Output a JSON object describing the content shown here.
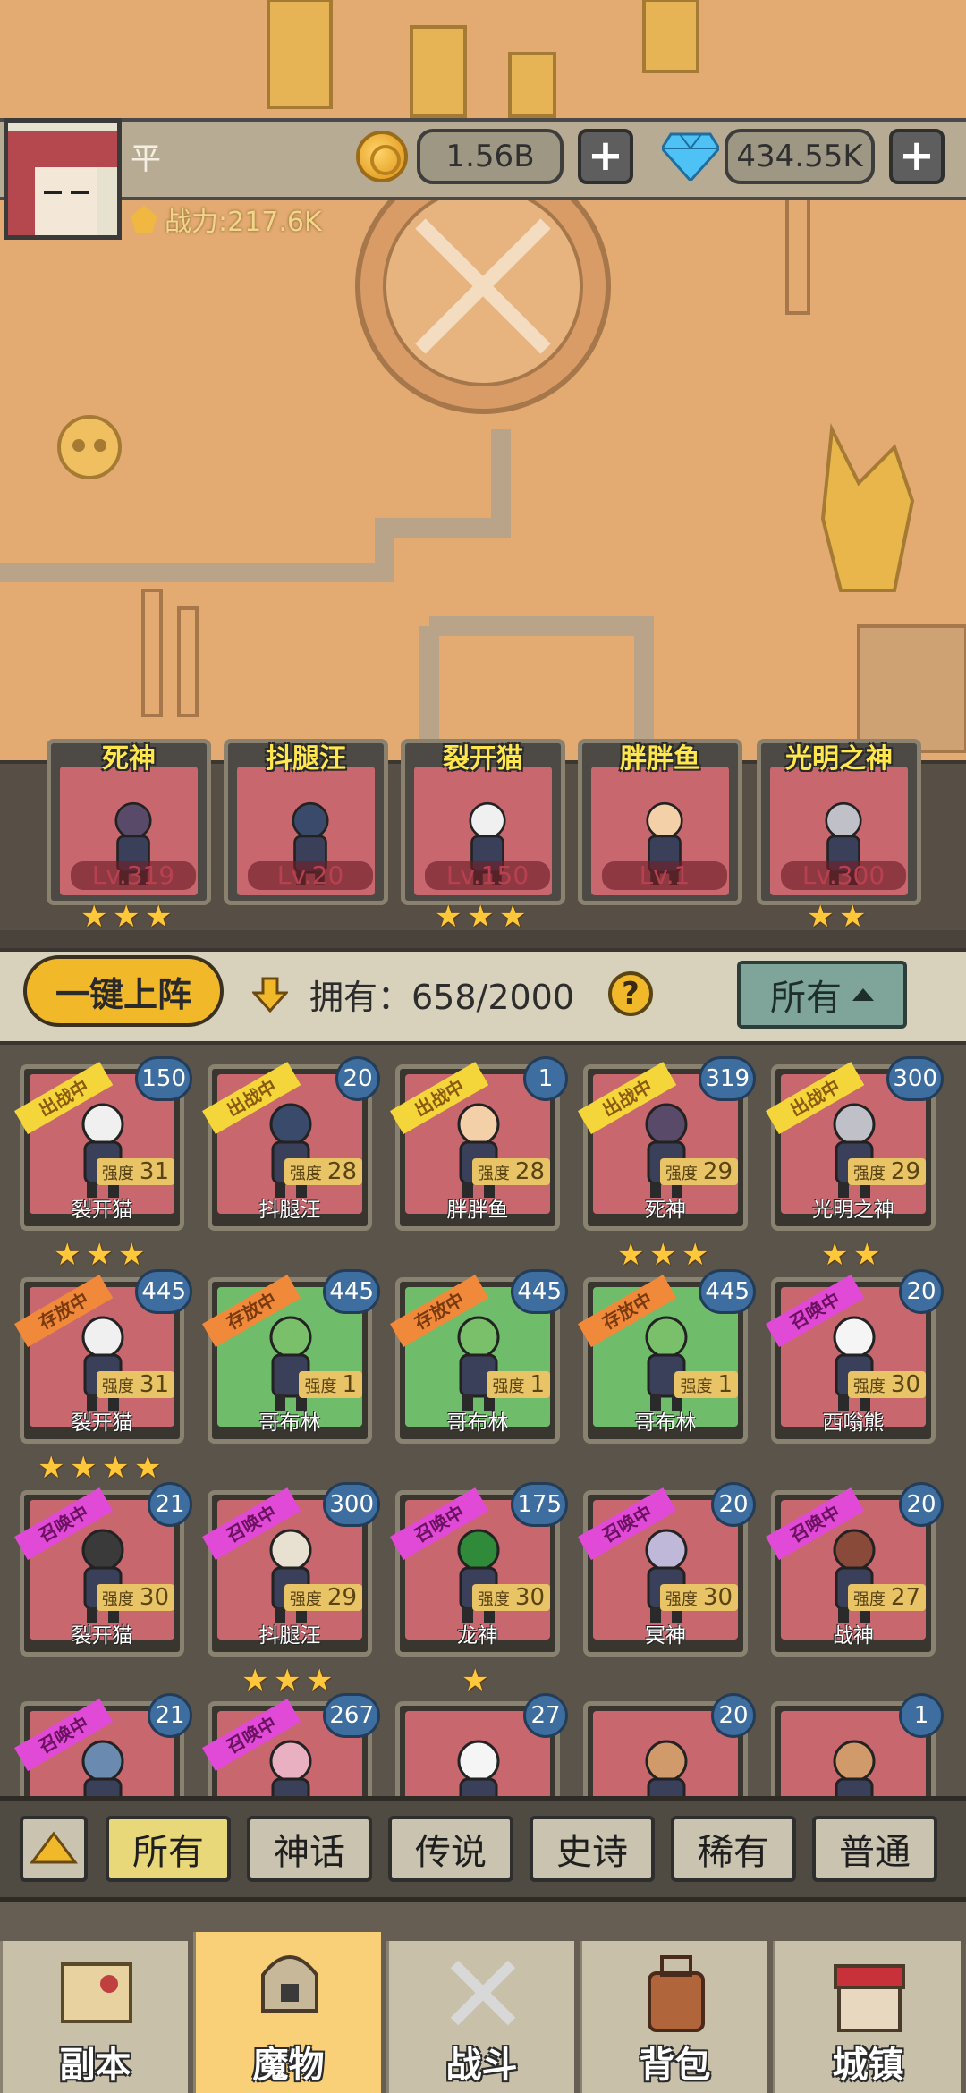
{
  "header": {
    "player_name": "平",
    "gold": "1.56B",
    "gems": "434.55K",
    "power": "战力:217.6K"
  },
  "lineup": [
    {
      "name": "死神",
      "level": "Lv.319",
      "stars": 3
    },
    {
      "name": "抖腿汪",
      "level": "Lv.20",
      "stars": 0
    },
    {
      "name": "裂开猫",
      "level": "Lv.150",
      "stars": 3
    },
    {
      "name": "胖胖鱼",
      "level": "Lv.1",
      "stars": 0
    },
    {
      "name": "光明之神",
      "level": "Lv.300",
      "stars": 2
    }
  ],
  "controls": {
    "auto_deploy": "一键上阵",
    "owned": "拥有：658/2000",
    "help": "?",
    "filter": "所有"
  },
  "grid": {
    "strength_label": "强度",
    "cards": [
      {
        "name": "裂开猫",
        "level": "150",
        "strength": "31",
        "status": "出战中",
        "type": "deployed",
        "bg": "red",
        "stars": 3
      },
      {
        "name": "抖腿汪",
        "level": "20",
        "strength": "28",
        "status": "出战中",
        "type": "deployed",
        "bg": "red",
        "stars": 0
      },
      {
        "name": "胖胖鱼",
        "level": "1",
        "strength": "28",
        "status": "出战中",
        "type": "deployed",
        "bg": "red",
        "stars": 0
      },
      {
        "name": "死神",
        "level": "319",
        "strength": "29",
        "status": "出战中",
        "type": "deployed",
        "bg": "red",
        "stars": 3
      },
      {
        "name": "光明之神",
        "level": "300",
        "strength": "29",
        "status": "出战中",
        "type": "deployed",
        "bg": "red",
        "stars": 2
      },
      {
        "name": "裂开猫",
        "level": "445",
        "strength": "31",
        "status": "存放中",
        "type": "stored",
        "bg": "red",
        "stars": 4
      },
      {
        "name": "哥布林",
        "level": "445",
        "strength": "1",
        "status": "存放中",
        "type": "stored",
        "bg": "green",
        "stars": 0
      },
      {
        "name": "哥布林",
        "level": "445",
        "strength": "1",
        "status": "存放中",
        "type": "stored",
        "bg": "green",
        "stars": 0
      },
      {
        "name": "哥布林",
        "level": "445",
        "strength": "1",
        "status": "存放中",
        "type": "stored",
        "bg": "green",
        "stars": 0
      },
      {
        "name": "西嗡熊",
        "level": "20",
        "strength": "30",
        "status": "召唤中",
        "type": "summon",
        "bg": "red",
        "stars": 0
      },
      {
        "name": "裂开猫",
        "level": "21",
        "strength": "30",
        "status": "召唤中",
        "type": "summon",
        "bg": "red",
        "stars": 0
      },
      {
        "name": "抖腿汪",
        "level": "300",
        "strength": "29",
        "status": "召唤中",
        "type": "summon",
        "bg": "red",
        "stars": 3
      },
      {
        "name": "龙神",
        "level": "175",
        "strength": "30",
        "status": "召唤中",
        "type": "summon",
        "bg": "red",
        "stars": 1
      },
      {
        "name": "冥神",
        "level": "20",
        "strength": "30",
        "status": "召唤中",
        "type": "summon",
        "bg": "red",
        "stars": 0
      },
      {
        "name": "战神",
        "level": "20",
        "strength": "27",
        "status": "召唤中",
        "type": "summon",
        "bg": "red",
        "stars": 0
      },
      {
        "name": "",
        "level": "21",
        "strength": "",
        "status": "召唤中",
        "type": "summon",
        "bg": "red",
        "stars": 0
      },
      {
        "name": "",
        "level": "267",
        "strength": "",
        "status": "召唤中",
        "type": "summon",
        "bg": "red",
        "stars": 0
      },
      {
        "name": "",
        "level": "27",
        "strength": "",
        "status": "",
        "type": "none",
        "bg": "red",
        "stars": 0
      },
      {
        "name": "",
        "level": "20",
        "strength": "",
        "status": "",
        "type": "none",
        "bg": "red",
        "stars": 0
      },
      {
        "name": "",
        "level": "1",
        "strength": "",
        "status": "",
        "type": "none",
        "bg": "red",
        "stars": 0
      }
    ]
  },
  "rarity_tabs": [
    "所有",
    "神话",
    "传说",
    "史诗",
    "稀有",
    "普通"
  ],
  "bottom_nav": [
    "副本",
    "魔物",
    "战斗",
    "背包",
    "城镇"
  ],
  "colors": {
    "map_bg": "#e3aa72",
    "card_red": "#c9676f",
    "card_green": "#6fbd6a",
    "accent_gold": "#f1b92a",
    "active_tab": "#e8d879",
    "nav_active": "#f9cf78"
  }
}
